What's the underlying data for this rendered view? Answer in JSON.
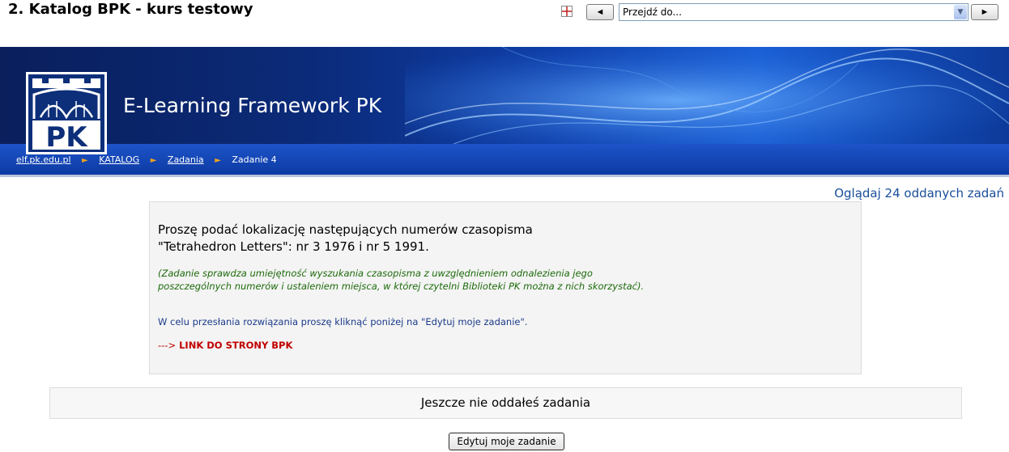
{
  "header": {
    "course_title": "2. Katalog BPK - kurs testowy",
    "jump_placeholder": "Przejdź do...",
    "prev_symbol": "◄",
    "next_symbol": "►"
  },
  "banner": {
    "title": "E-Learning Framework PK",
    "logo_text": "PK"
  },
  "breadcrumb": {
    "items": [
      "elf.pk.edu.pl",
      "KATALOG",
      "Zadania",
      "Zadanie 4"
    ],
    "separator": "►"
  },
  "submissions_link": "Oglądaj 24 oddanych zadań",
  "task": {
    "question_line1": "Proszę podać lokalizację następujących numerów czasopisma",
    "question_line2": "\"Tetrahedron Letters\": nr 3 1976 i nr 5 1991.",
    "note": "(Zadanie sprawdza umiejętność wyszukania czasopisma z uwzględnieniem odnalezienia jego poszczególnych numerów i ustaleniem miejsca, w której czytelni Biblioteki PK można z nich skorzystać).",
    "instruction": "W celu przesłania rozwiązania proszę kliknąć poniżej na \"Edytuj moje zadanie\".",
    "link_arrow": "--->",
    "link_text": "LINK DO STRONY BPK"
  },
  "status": "Jeszcze nie oddałeś zadania",
  "edit_button": "Edytuj moje zadanie",
  "colors": {
    "banner_dark": "#0a1f5c",
    "breadcrumb_bar": "#1d54c9",
    "separator": "#f3a31b",
    "note_green": "#1c6a0a",
    "link_red": "#c00000",
    "submissions_blue": "#1a4e9a"
  }
}
